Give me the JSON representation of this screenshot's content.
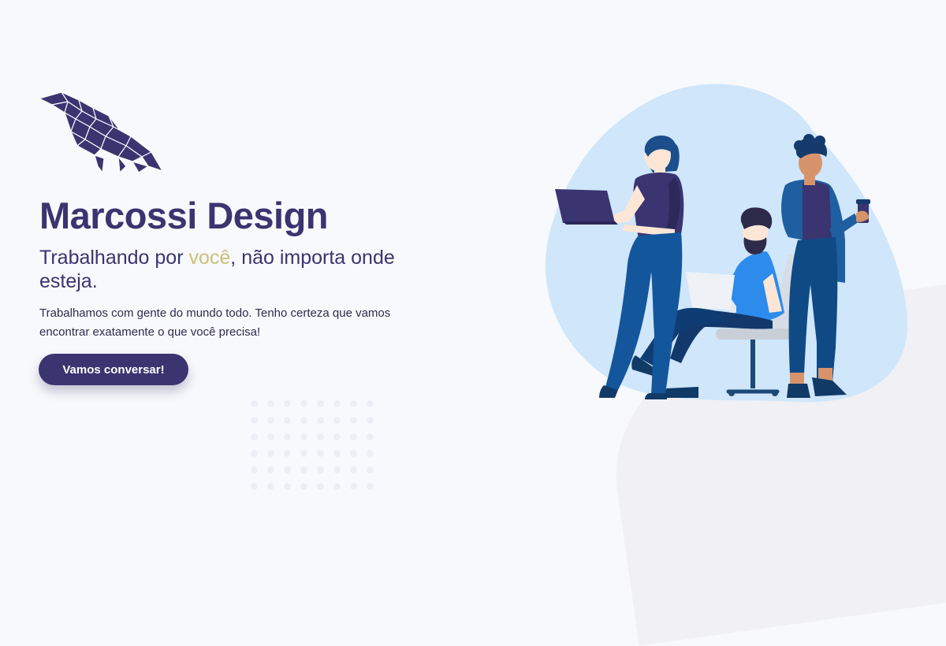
{
  "hero": {
    "title": "Marcossi Design",
    "tagline_before": "Trabalhando por ",
    "tagline_highlight": "você",
    "tagline_after": ", não importa onde esteja.",
    "description": "Trabalhamos com gente do mundo todo. Tenho certeza que vamos encontrar exatamente o que você precisa!",
    "cta_label": "Vamos conversar!"
  },
  "colors": {
    "brand": "#3a3470",
    "highlight": "#c9c27a",
    "blob": "#cfe6fb",
    "background": "#f8f9fc"
  },
  "icons": {
    "logo": "raven-logo-icon",
    "illustration": "team-working-illustration"
  }
}
